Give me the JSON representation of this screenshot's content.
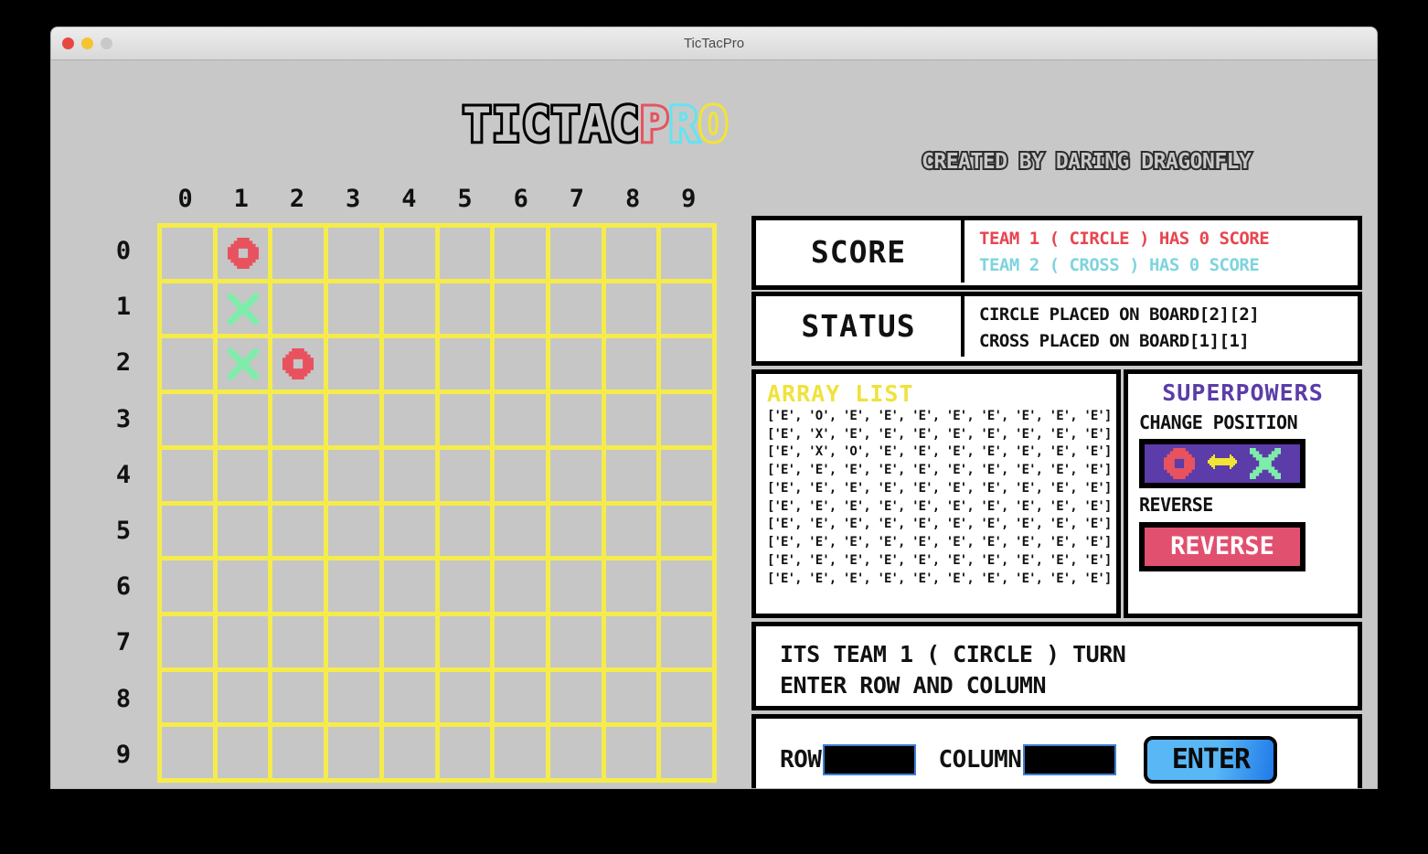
{
  "window": {
    "title": "TicTacPro",
    "controls": [
      "close",
      "minimize",
      "maximize"
    ]
  },
  "header": {
    "logo_parts": [
      {
        "text": "TICTAC",
        "outline": "#000000"
      },
      {
        "text": "P",
        "outline": "#e8525f"
      },
      {
        "text": "R",
        "outline": "#63e4f0"
      },
      {
        "text": "O",
        "outline": "#f2e435"
      }
    ],
    "credit": "CREATED BY DARING DRAGONFLY"
  },
  "board": {
    "column_labels": [
      "0",
      "1",
      "2",
      "3",
      "4",
      "5",
      "6",
      "7",
      "8",
      "9"
    ],
    "row_labels": [
      "0",
      "1",
      "2",
      "3",
      "4",
      "5",
      "6",
      "7",
      "8",
      "9"
    ],
    "size": 10,
    "grid_color": "#f5ec4b",
    "cell_color": "#c6c6c6",
    "circle_color": "#e8525f",
    "cross_color": "#7fedaa",
    "marks": [
      {
        "row": 0,
        "col": 1,
        "type": "circle"
      },
      {
        "row": 1,
        "col": 1,
        "type": "cross"
      },
      {
        "row": 2,
        "col": 1,
        "type": "cross"
      },
      {
        "row": 2,
        "col": 2,
        "type": "circle"
      }
    ]
  },
  "score": {
    "label": "SCORE",
    "team1_line": "TEAM 1 ( CIRCLE ) HAS 0 SCORE",
    "team2_line": "TEAM 2 ( CROSS ) HAS 0 SCORE",
    "team1_color": "#e8454f",
    "team2_color": "#7fd4de"
  },
  "status": {
    "label": "STATUS",
    "line1": "CIRCLE PLACED ON BOARD[2][2]",
    "line2": "CROSS PLACED ON BOARD[1][1]"
  },
  "array_list": {
    "title": "ARRAY LIST",
    "title_color": "#f0e23c",
    "rows": [
      "['E', 'O', 'E', 'E', 'E', 'E', 'E', 'E', 'E', 'E']",
      "['E', 'X', 'E', 'E', 'E', 'E', 'E', 'E', 'E', 'E']",
      "['E', 'X', 'O', 'E', 'E', 'E', 'E', 'E', 'E', 'E']",
      "['E', 'E', 'E', 'E', 'E', 'E', 'E', 'E', 'E', 'E']",
      "['E', 'E', 'E', 'E', 'E', 'E', 'E', 'E', 'E', 'E']",
      "['E', 'E', 'E', 'E', 'E', 'E', 'E', 'E', 'E', 'E']",
      "['E', 'E', 'E', 'E', 'E', 'E', 'E', 'E', 'E', 'E']",
      "['E', 'E', 'E', 'E', 'E', 'E', 'E', 'E', 'E', 'E']",
      "['E', 'E', 'E', 'E', 'E', 'E', 'E', 'E', 'E', 'E']",
      "['E', 'E', 'E', 'E', 'E', 'E', 'E', 'E', 'E', 'E']"
    ]
  },
  "superpowers": {
    "title": "SUPERPOWERS",
    "title_color": "#5b3ca8",
    "change_position_label": "CHANGE POSITION",
    "reverse_label": "REVERSE",
    "reverse_button_label": "REVERSE",
    "change_button_bg": "#5b3ca8",
    "reverse_button_bg": "#e2506f",
    "swap_arrow_color": "#f2e435"
  },
  "turn": {
    "line1": "ITS TEAM 1 ( CIRCLE ) TURN",
    "line2": "ENTER ROW AND COLUMN"
  },
  "input": {
    "row_label": "ROW",
    "row_value": "",
    "row_placeholder": "",
    "column_label": "COLUMN",
    "column_value": "",
    "column_placeholder": "",
    "enter_label": "ENTER"
  }
}
